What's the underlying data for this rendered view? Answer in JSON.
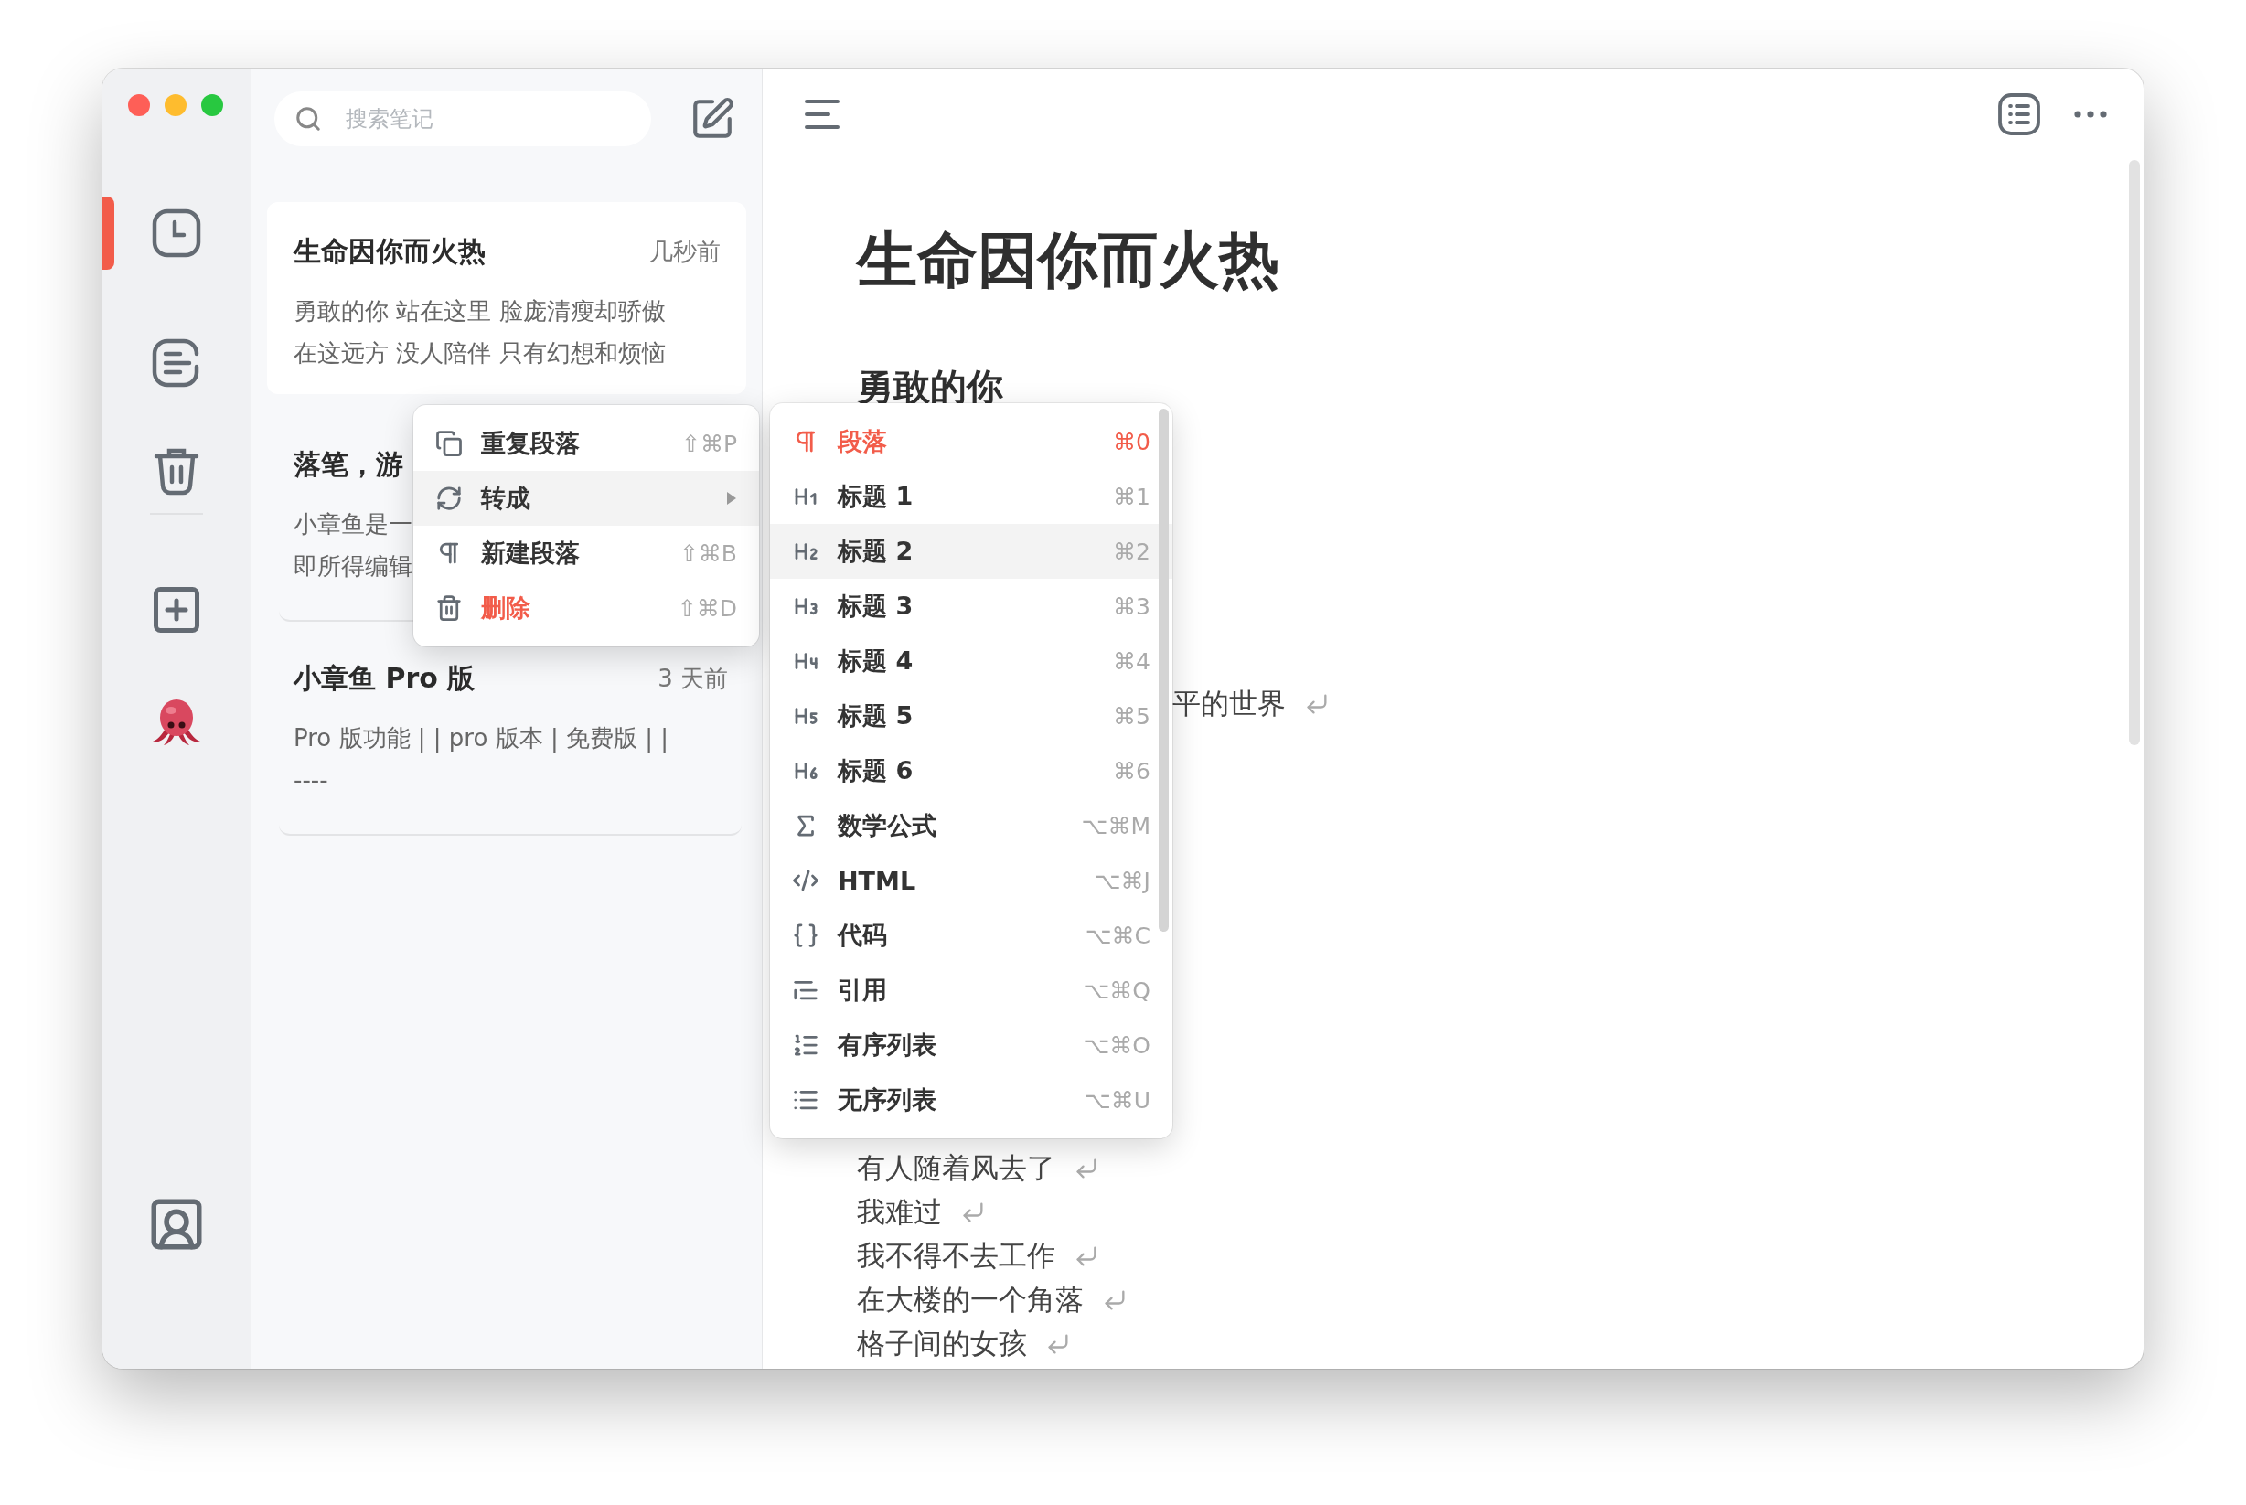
{
  "rail": [
    {
      "kind": "recent",
      "selected": true
    },
    {
      "kind": "notes",
      "selected": false
    },
    {
      "kind": "trash",
      "selected": false
    },
    {
      "kind": "new",
      "selected": false
    },
    {
      "kind": "octopus",
      "selected": false
    },
    {
      "kind": "account",
      "selected": false
    }
  ],
  "search": {
    "placeholder": "搜索笔记"
  },
  "notes": [
    {
      "title": "生命因你而火热",
      "time": "几秒前",
      "preview": [
        "勇敢的你 站在这里 脸庞清瘦却骄傲",
        "在这远方 没人陪伴 只有幻想和烦恼"
      ],
      "selected": true
    },
    {
      "title": "落笔，游",
      "preview": [
        "小章鱼是一",
        "即所得编辑"
      ],
      "selected": false
    },
    {
      "title": "小章鱼 Pro 版",
      "time": "3 天前",
      "preview": [
        "Pro 版功能 | | pro 版本 | 免费版 | |",
        "----"
      ],
      "selected": false
    }
  ],
  "editor": {
    "title": "生命因你而火热",
    "heading": "勇敢的你",
    "fragment": "平的世界",
    "lines": [
      "有人随着风去了",
      "我难过",
      "我不得不去工作",
      "在大楼的一个角落",
      "格子间的女孩"
    ]
  },
  "context_menu": {
    "items": [
      {
        "kind": "duplicate",
        "label": "重复段落",
        "shortcut": "⇧⌘P",
        "submenu": false,
        "highlighted": false,
        "danger": false
      },
      {
        "kind": "convert",
        "label": "转成",
        "submenu": true,
        "highlighted": true,
        "danger": false
      },
      {
        "kind": "paragraph",
        "label": "新建段落",
        "shortcut": "⇧⌘B",
        "submenu": false,
        "highlighted": false,
        "danger": false
      },
      {
        "kind": "delete",
        "label": "删除",
        "shortcut": "⇧⌘D",
        "submenu": false,
        "highlighted": false,
        "danger": true
      }
    ]
  },
  "convert_menu": {
    "items": [
      {
        "kind": "paragraph",
        "label": "段落",
        "shortcut": "⌘0",
        "current": true,
        "highlighted": false
      },
      {
        "kind": "h1",
        "label": "标题 1",
        "shortcut": "⌘1",
        "current": false,
        "highlighted": false
      },
      {
        "kind": "h2",
        "label": "标题 2",
        "shortcut": "⌘2",
        "current": false,
        "highlighted": true
      },
      {
        "kind": "h3",
        "label": "标题 3",
        "shortcut": "⌘3",
        "current": false,
        "highlighted": false
      },
      {
        "kind": "h4",
        "label": "标题 4",
        "shortcut": "⌘4",
        "current": false,
        "highlighted": false
      },
      {
        "kind": "h5",
        "label": "标题 5",
        "shortcut": "⌘5",
        "current": false,
        "highlighted": false
      },
      {
        "kind": "h6",
        "label": "标题 6",
        "shortcut": "⌘6",
        "current": false,
        "highlighted": false
      },
      {
        "kind": "math",
        "label": "数学公式",
        "shortcut": "⌥⌘M",
        "current": false,
        "highlighted": false
      },
      {
        "kind": "html",
        "label": "HTML",
        "shortcut": "⌥⌘J",
        "current": false,
        "highlighted": false
      },
      {
        "kind": "code",
        "label": "代码",
        "shortcut": "⌥⌘C",
        "current": false,
        "highlighted": false
      },
      {
        "kind": "quote",
        "label": "引用",
        "shortcut": "⌥⌘Q",
        "current": false,
        "highlighted": false
      },
      {
        "kind": "ordered",
        "label": "有序列表",
        "shortcut": "⌥⌘O",
        "current": false,
        "highlighted": false
      },
      {
        "kind": "unordered",
        "label": "无序列表",
        "shortcut": "⌥⌘U",
        "current": false,
        "highlighted": false
      }
    ]
  }
}
